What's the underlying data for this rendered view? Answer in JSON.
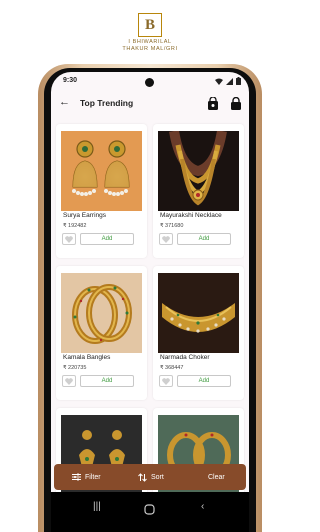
{
  "brand": {
    "letter": "B",
    "line1": "I BHIWARILAL",
    "line2": "THAKUR MAL/GRI"
  },
  "status_bar": {
    "time": "9:30"
  },
  "appbar": {
    "title": "Top Trending"
  },
  "products": [
    {
      "name": "Surya Earrings",
      "price": "₹ 192482",
      "add_label": "Add"
    },
    {
      "name": "Mayurakshi Necklace",
      "price": "₹ 371680",
      "add_label": "Add"
    },
    {
      "name": "Kamala Bangles",
      "price": "₹ 220735",
      "add_label": "Add"
    },
    {
      "name": "Narmada Choker",
      "price": "₹ 368447",
      "add_label": "Add"
    },
    {
      "name": "",
      "price": "",
      "add_label": ""
    },
    {
      "name": "",
      "price": "",
      "add_label": ""
    }
  ],
  "bottom_actions": {
    "filter": "Filter",
    "sort": "Sort",
    "clear": "Clear"
  },
  "colors": {
    "accent": "#874b2a",
    "add_text": "#3e9a3e",
    "gold": "#b8860b"
  },
  "icons": [
    "back-arrow-icon",
    "bag-icon",
    "lock-bag-icon",
    "heart-icon",
    "filter-icon",
    "sort-icon",
    "wifi-icon",
    "signal-icon",
    "battery-icon"
  ]
}
